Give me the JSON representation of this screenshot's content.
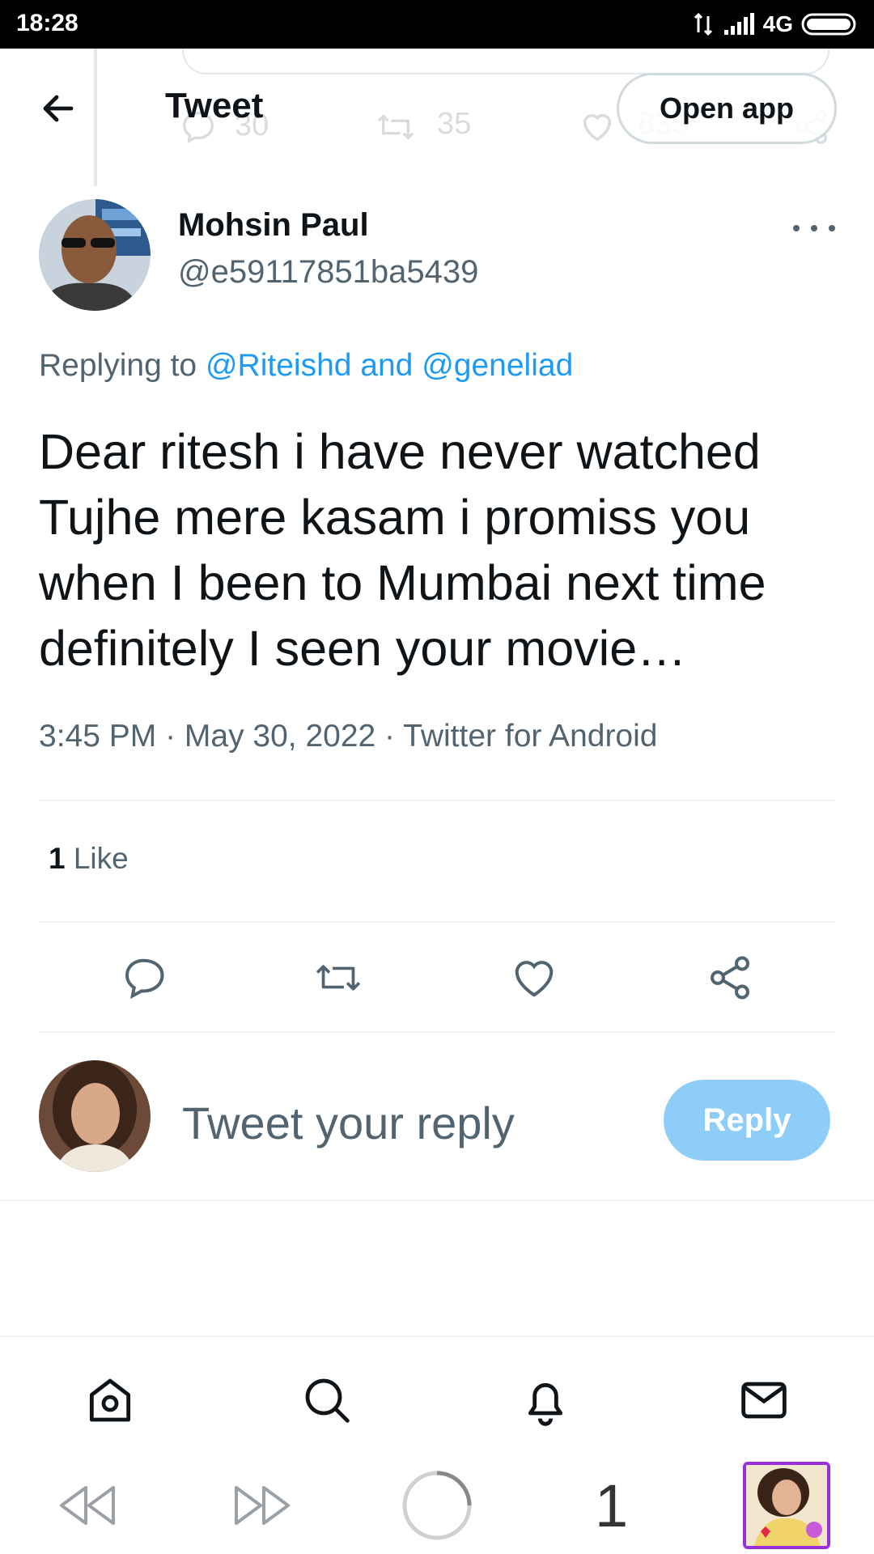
{
  "status_bar": {
    "time": "18:28",
    "network": "4G"
  },
  "header": {
    "title": "Tweet",
    "open_app_label": "Open app",
    "back_icon": "arrow-left-icon"
  },
  "ghost": {
    "reply_count": "30",
    "retweet_count": "35",
    "like_count": "835"
  },
  "tweet": {
    "author_name": "Mohsin Paul",
    "author_handle": "@e59117851ba5439",
    "replying_prefix": "Replying to",
    "replying_to": "@Riteishd and @geneliad",
    "text": "Dear ritesh i have never watched Tujhe mere kasam i promiss you when I been to Mumbai next time definitely I seen your movie…",
    "meta": "3:45 PM · May 30, 2022 · Twitter for Android",
    "like_count": "1",
    "like_label": "Like"
  },
  "actions": [
    "reply-icon",
    "retweet-icon",
    "like-icon",
    "share-icon"
  ],
  "composer": {
    "placeholder": "Tweet your reply",
    "reply_label": "Reply"
  },
  "bottom_nav": [
    "home-icon",
    "search-icon",
    "notifications-icon",
    "messages-icon"
  ],
  "system_bar": {
    "tab_count": "1"
  },
  "colors": {
    "accent": "#1d9bf0",
    "reply_button_disabled": "#8ecdf8",
    "secondary_text": "#536471",
    "primary_text": "#0f1419",
    "divider": "#eff3f4"
  }
}
